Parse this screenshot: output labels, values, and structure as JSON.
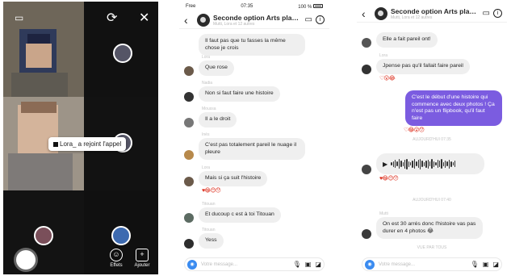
{
  "call": {
    "toast": "Lora_ a rejoint l'appel",
    "controls": [
      {
        "label": "Effets",
        "icon": "effects-icon"
      },
      {
        "label": "Ajouter",
        "icon": "add-person-icon"
      }
    ]
  },
  "chat_middle": {
    "status": {
      "carrier": "Free",
      "time": "07:35",
      "battery": "100 %"
    },
    "title": "Seconde option Arts plast...",
    "subtitle": "Mutti, Lora et 12 autres",
    "composer_placeholder": "Votre message...",
    "messages": [
      {
        "text": "Il faut pas que tu fasses la même chose je crois",
        "sender": ""
      },
      {
        "text": "Que rose",
        "sender": "Lora"
      },
      {
        "text": "Non si faut faire une histoire",
        "sender": "Nadia"
      },
      {
        "text": "Il a le droit",
        "sender": "Moussa"
      },
      {
        "text": "C'est pas totalement pareil le nuage il pleure",
        "sender": "Inès"
      },
      {
        "text": "Mais si ça suit l'histoire",
        "sender": "Lora"
      },
      {
        "text": "Et ducoup c est à toi Titouan",
        "sender": "Titouan"
      },
      {
        "text": "Yess",
        "sender": "Titouan"
      }
    ],
    "reaction": "♥😂😊😯"
  },
  "chat_right": {
    "title": "Seconde option Arts plast...",
    "subtitle": "Mutti, Lora et 12 autres",
    "composer_placeholder": "Votre message...",
    "messages": [
      {
        "text": "Elle a fait pareil ont!",
        "sender": ""
      },
      {
        "text": "Jpense pas qu'il fallait faire pareil",
        "sender": "Lora"
      },
      {
        "text": "C'est le début d'une histoire qui commence avec deux photos ! Ça n'est pas un flipbook, qu'il faut faire",
        "sender": "",
        "outgoing": true
      },
      {
        "text": "On est 30 arrés donc l'histoire vas pas durer en 4 photos 😂",
        "sender": "Mutti"
      }
    ],
    "reactions": [
      "♡😮😂",
      "♡😂😮😯",
      "♥😂😊😯"
    ],
    "stamps": [
      "AUJOURD'HUI 07:35",
      "AUJOURD'HUI 07:40",
      "VUE PAR TOUS"
    ],
    "voice_label": "voice-message"
  },
  "colors": {
    "outgoing_bubble": "#7b5ce0",
    "incoming_bubble": "#efefef",
    "camera_button": "#3a8bf0"
  }
}
